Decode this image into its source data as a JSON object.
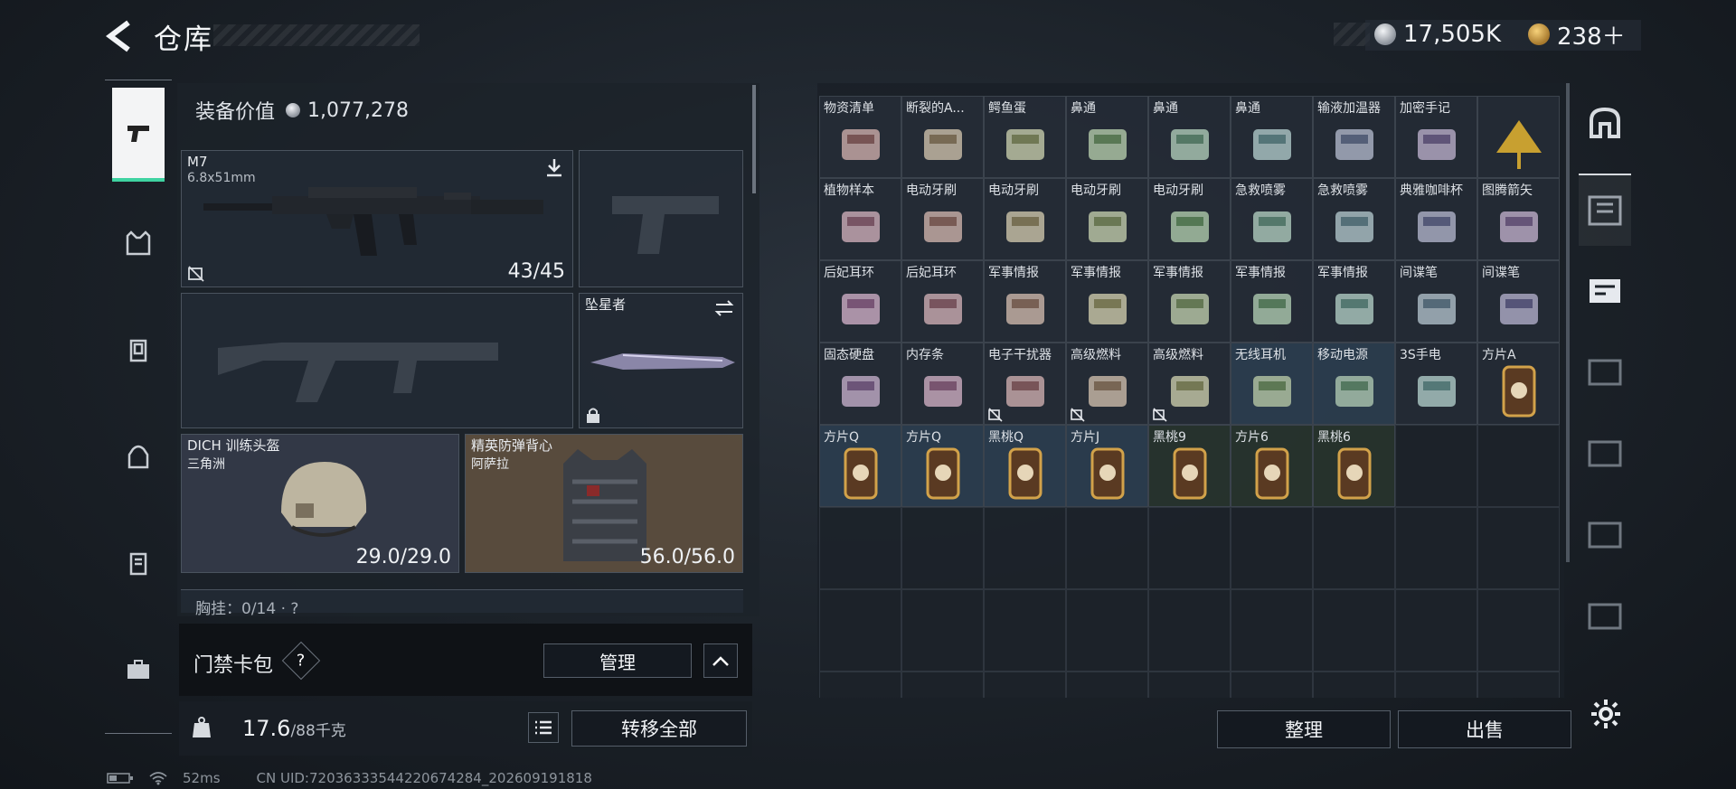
{
  "header": {
    "title": "仓库"
  },
  "currency": {
    "silver": "17,505K",
    "gold": "238＋"
  },
  "equipment": {
    "value_label": "装备价值",
    "value": "1,077,278",
    "primary": {
      "name": "M7",
      "caliber": "6.8x51mm",
      "ammo": "43/45"
    },
    "melee": {
      "name": "坠星者"
    },
    "helmet": {
      "name": "DICH 训练头盔",
      "sub": "三角洲",
      "durability": "29.0/29.0"
    },
    "armor": {
      "name": "精英防弹背心",
      "sub": "阿萨拉",
      "durability": "56.0/56.0"
    },
    "rig": {
      "label": "胸挂：0/14 · ?"
    }
  },
  "keycard": {
    "label": "门禁卡包",
    "help": "?",
    "manage": "管理",
    "collapse": "︿"
  },
  "weight": {
    "current": "17.6",
    "max": "/88千克"
  },
  "actions": {
    "transfer_all": "转移全部",
    "sort": "整理",
    "sell": "出售"
  },
  "status": {
    "ping": "52ms",
    "uid": "CN UID:7203633354422067428​4_202609191818"
  },
  "storage": {
    "rows": [
      [
        "物资清单",
        "断裂的A...",
        "鳄鱼蛋",
        "鼻通",
        "鼻通",
        "鼻通",
        "输液加温器",
        "加密手记",
        ""
      ],
      [
        "植物样本",
        "电动牙刷",
        "电动牙刷",
        "电动牙刷",
        "电动牙刷",
        "急救喷雾",
        "急救喷雾",
        "典雅咖啡杯",
        "图腾箭矢"
      ],
      [
        "后妃耳环",
        "后妃耳环",
        "军事情报",
        "军事情报",
        "军事情报",
        "军事情报",
        "军事情报",
        "间谍笔",
        "间谍笔"
      ],
      [
        "固态硬盘",
        "内存条",
        "电子干扰器",
        "高级燃料",
        "高级燃料",
        "无线耳机",
        "移动电源",
        "3S手电",
        "方片A"
      ],
      [
        "方片Q",
        "方片Q",
        "黑桃Q",
        "方片J",
        "黑桃9",
        "方片6",
        "黑桃6",
        "",
        ""
      ]
    ]
  },
  "colors": {
    "accent": "#3fd3a1",
    "panel": "#1c232a"
  }
}
